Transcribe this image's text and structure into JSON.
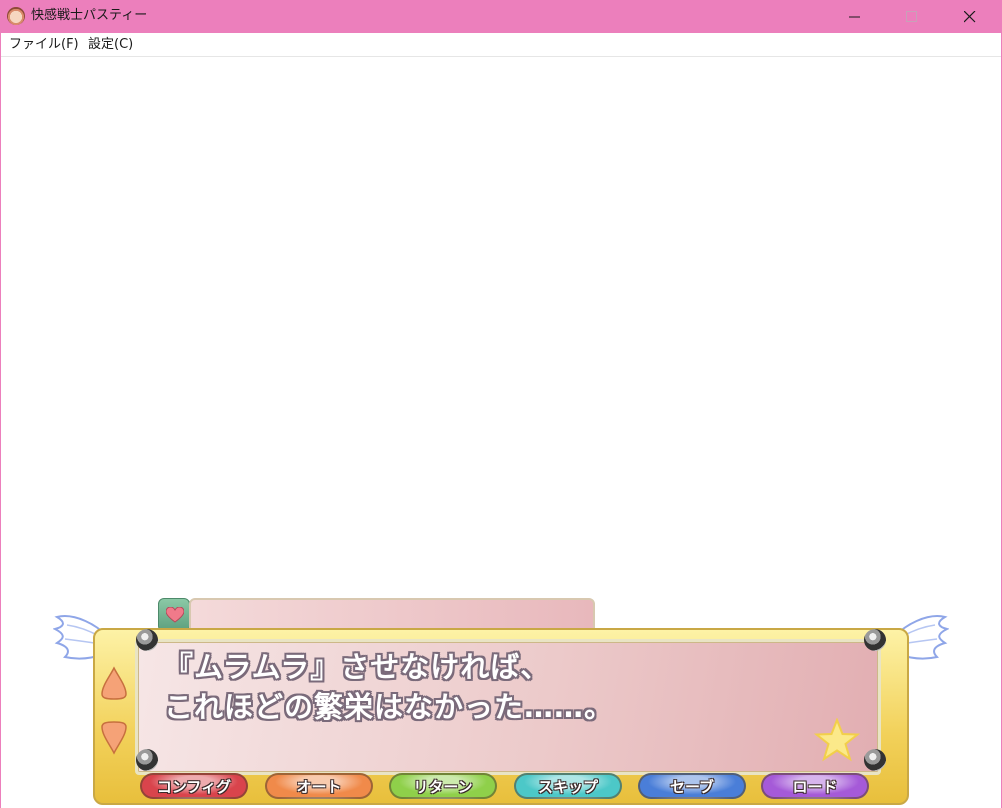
{
  "window": {
    "title": "快感戦士パスティー"
  },
  "menubar": {
    "items": [
      {
        "label": "ファイル(F)"
      },
      {
        "label": "設定(C)"
      }
    ]
  },
  "game": {
    "speaker_name": "",
    "dialogue": {
      "line1": "『ムラムラ』させなければ、",
      "line2": "これほどの繁栄はなかった……。"
    },
    "buttons": [
      {
        "label": "コンフィグ",
        "color": "#d9444c"
      },
      {
        "label": "オート",
        "color": "#f08a4a"
      },
      {
        "label": "リターン",
        "color": "#8fd04a"
      },
      {
        "label": "スキップ",
        "color": "#4cc8c8"
      },
      {
        "label": "セーブ",
        "color": "#4a7ed8"
      },
      {
        "label": "ロード",
        "color": "#a55ad8"
      }
    ]
  },
  "colors": {
    "titlebar": "#ec7fbc",
    "panel_gold": "#f2d15a",
    "dialogue_pink": "#eccaca"
  }
}
